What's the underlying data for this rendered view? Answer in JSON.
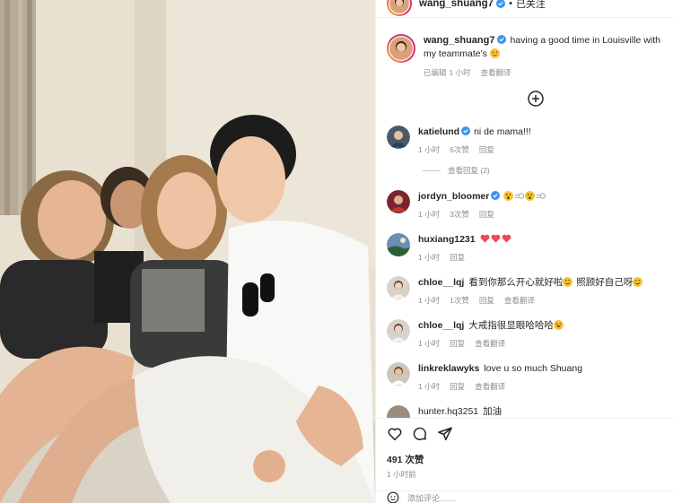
{
  "post": {
    "author": "wang_shuang7",
    "follow_label": "已关注",
    "separator": "•",
    "caption_text": "having a good time in Louisville with my teammate's",
    "caption_emoji": "smiling-face-with-heart-eyes",
    "edited_label": "已编辑",
    "caption_time": "1 小时",
    "translate_label": "查看翻译",
    "likes_label": "491 次赞",
    "posted_time": "1 小时前",
    "add_comment_placeholder": "添加评论……"
  },
  "comments": [
    {
      "user": "katielund",
      "verified": true,
      "text": "ni de mama!!!",
      "time": "1 小时",
      "likes": "6次赞",
      "reply": "回复",
      "translate": "",
      "view_replies": "查看回复 (2)"
    },
    {
      "user": "jordyn_bloomer",
      "verified": true,
      "text": "",
      "emojis": [
        "astonished-face",
        "dashing-away",
        "astonished-face",
        "dashing-away"
      ],
      "time": "1 小时",
      "likes": "3次赞",
      "reply": "回复",
      "translate": ""
    },
    {
      "user": "huxiang1231",
      "verified": false,
      "text": "",
      "emojis": [
        "red-heart",
        "red-heart",
        "red-heart"
      ],
      "time": "1 小时",
      "likes": "",
      "reply": "回复",
      "translate": ""
    },
    {
      "user": "chloe__lqj",
      "verified": false,
      "text": "看到你那么开心就好啦",
      "text2": " 照顾好自己呀",
      "emojis": [
        "smiling-face",
        "smiling-face"
      ],
      "time": "1 小时",
      "likes": "1次赞",
      "reply": "回复",
      "translate": "查看翻译"
    },
    {
      "user": "chloe__lqj",
      "verified": false,
      "text": "大戒指很显眼哈哈哈",
      "emojis": [
        "grinning-face"
      ],
      "time": "1 小时",
      "likes": "",
      "reply": "回复",
      "translate": "查看翻译"
    },
    {
      "user": "linkreklawyks",
      "verified": false,
      "text": "love u so much Shuang",
      "time": "1 小时",
      "likes": "",
      "reply": "回复",
      "translate": "查看翻译"
    },
    {
      "user": "hunter.hq3251",
      "verified": false,
      "text": "加油",
      "time": "",
      "likes": "",
      "reply": "",
      "translate": ""
    }
  ],
  "colors": {
    "verified": "#3897f0",
    "muted": "#8e8e8e",
    "heart": "#ed4956",
    "emoji": "#f7c331"
  }
}
